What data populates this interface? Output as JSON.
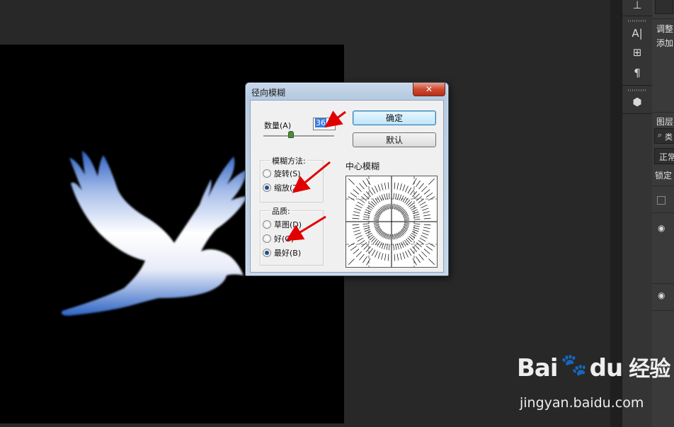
{
  "dialog": {
    "title": "径向模糊",
    "close_label": "✕",
    "amount_label": "数量(A)",
    "amount_value": "36",
    "ok_label": "确定",
    "reset_label": "默认",
    "method_group_label": "模糊方法:",
    "method_options": [
      {
        "label": "旋转(S)",
        "selected": false
      },
      {
        "label": "缩放(Z)",
        "selected": true
      }
    ],
    "quality_group_label": "品质:",
    "quality_options": [
      {
        "label": "草图(D)",
        "selected": false
      },
      {
        "label": "好(G)",
        "selected": false
      },
      {
        "label": "最好(B)",
        "selected": true
      }
    ],
    "center_label": "中心模糊"
  },
  "right_panel": {
    "adjust_label": "调整",
    "add_label": "添加",
    "layers_label": "图层",
    "search_prefix": "类",
    "blend_mode": "正常",
    "lock_label": "锁定"
  },
  "tool_icons": [
    "type-character-icon",
    "paragraph-styles-icon",
    "paragraph-icon",
    "3d-cube-icon"
  ],
  "watermark": {
    "logo_text": "Bai",
    "logo_suffix": "du",
    "brand_text": "经验",
    "url": "jingyan.baidu.com"
  },
  "colors": {
    "workspace": "#282828",
    "canvas": "#000000",
    "dove_top": "#ffffff",
    "dove_bottom": "#2d64c4",
    "arrow": "#e00000"
  }
}
